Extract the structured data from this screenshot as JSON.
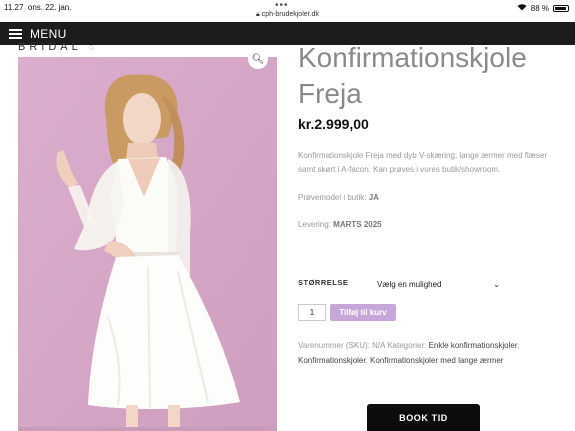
{
  "status": {
    "time": "11.27",
    "date": "ons. 22. jan.",
    "url": "cph-brudekjoler.dk",
    "battery": "88 %",
    "dots": "•••"
  },
  "menu": {
    "label": "MENU"
  },
  "brand": {
    "logo": "BRIDAL"
  },
  "product": {
    "title_line1": "Konfirmationskjole",
    "title_line2": "Freja",
    "price": "kr.2.999,00",
    "description": "Konfirmationskjole Freja med dyb V-skæring, lange ærmer med flæser samt skørt i A-facon. Kan prøves i vores butik/showroom.",
    "sample_label": "Prøvemodel i butik:",
    "sample_value": "JA",
    "delivery_label": "Levering:",
    "delivery_value": "MARTS 2025",
    "size_label": "STØRRELSE",
    "size_select": "Vælg en mulighed",
    "quantity": "1",
    "add_to_cart": "Tilføj til kurv",
    "sku_text": "Varenummer (SKU): N/A Kategorier:",
    "categories": [
      "Enkle konfirmationskjoler",
      "Konfirmationskjoler",
      "Konfirmationskjoler med lange ærmer"
    ]
  },
  "cta": {
    "book": "BOOK TID"
  },
  "colors": {
    "menu_bg": "#1c1c1c",
    "accent": "#c7a7d9",
    "photo_bg": "#d6a6c7"
  }
}
